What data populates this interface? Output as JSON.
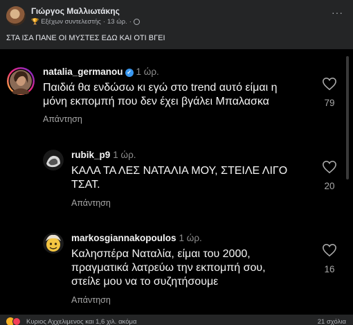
{
  "post": {
    "author": "Γιώργος Μαλλιωτάκης",
    "badge": "Εξέχων συντελεστής",
    "time": "13 ώρ.",
    "more": "···",
    "text": "ΣΤΑ ΙΣΑ ΠΑΝΕ ΟΙ ΜΥΣΤΕΣ ΕΔΩ ΚΑΙ ΟΤΙ ΒΓΕΙ"
  },
  "comments": [
    {
      "user": "natalia_germanou",
      "verified": true,
      "time": "1 ώρ.",
      "text_lines": [
        "Παιδιά θα ενδώσω κι εγώ στο trend αυτό είμαι η",
        "μόνη εκπομπή που δεν έχει βγάλει Μπαλασκα"
      ],
      "reply": "Απάντηση",
      "likes": "79"
    },
    {
      "user": "rubik_p9",
      "verified": false,
      "time": "1 ώρ.",
      "text_lines": [
        "ΚΑΛΑ ΤΑ ΛΕΣ ΝΑΤΑΛΙΑ ΜΟΥ, ΣΤΕΙΛΕ ΛΙΓΟ",
        "ΤΣΑΤ."
      ],
      "reply": "Απάντηση",
      "likes": "20"
    },
    {
      "user": "markosgiannakopoulos",
      "verified": false,
      "time": "1 ώρ.",
      "text_lines": [
        "Καλησπέρα Ναταλία, είμαι του 2000,",
        "πραγματικά λατρεύω την εκπομπή σου,",
        "στείλε μου να το συζητήσουμε"
      ],
      "reply": "Απάντηση",
      "likes": "16"
    }
  ],
  "footer": {
    "reactions_text": "Κυριος Αχχελιμενος και 1,6 χιλ. ακόμα",
    "comments_count": "21 σχόλια"
  },
  "colors": {
    "fb_bg": "#242526",
    "ig_bg": "#000000",
    "verified": "#3897f0"
  }
}
